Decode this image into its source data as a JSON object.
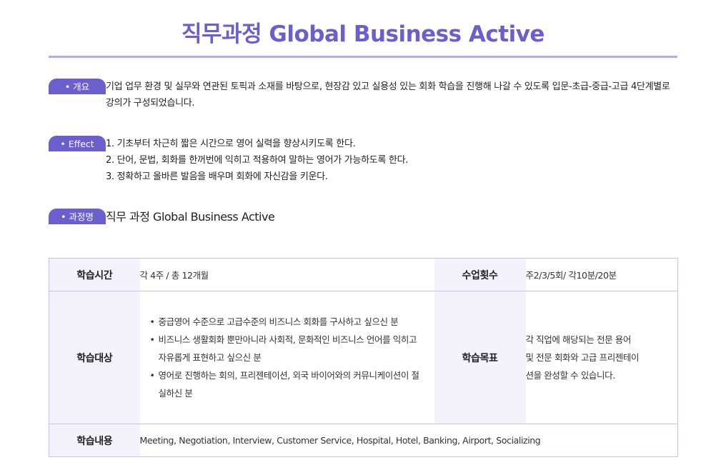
{
  "page": {
    "title": "직무과정 Global Business Active"
  },
  "sections": {
    "overview": {
      "label": "개요",
      "text": "기업 업무 환경 및 실무와 연관된 토픽과 소재를 바탕으로, 현장감 있고 실용성 있는 회화 학습을 진행해 나갈 수 있도록 입문-초급-중급-고급 4단계별로 강의가 구성되었습니다."
    },
    "effect": {
      "label": "Effect",
      "items": [
        "1. 기초부터 차근히 짧은 시간으로 영어 실력을 향상시키도록 한다.",
        "2. 단어, 문법, 회화를 한꺼번에 익히고 적용하여 말하는 영어가 가능하도록 한다.",
        "3. 정확하고 올바른 발음을 배우며 회화에 자신감을 키운다."
      ]
    },
    "course_name": {
      "label": "과정명",
      "text": "직무 과정 Global Business Active"
    }
  },
  "table": {
    "row1": {
      "duration_label": "학습시간",
      "duration_value": "각 4주 / 총 12개월",
      "frequency_label": "수업횟수",
      "frequency_value": "주2/3/5회/ 각10분/20분"
    },
    "row2": {
      "target_label": "학습대상",
      "target_items": [
        "중급영어 수준으로 고급수준의 비즈니스 회화를 구사하고 싶으신 분",
        "비즈니스 생활회화 뿐만아니라 사회적, 문화적인 비즈니스 언어를 익히고 자유롭게 표현하고 싶으신 분",
        "영어로 진행하는 회의, 프리젠테이션, 외국 바이어와의 커뮤니케이션이 절실하신 분"
      ],
      "goal_label": "학습목표",
      "goal_value": "각 직업에 해당되는 전문 용어 및 전문 회화와 고급 프리젠테이션을 완성할 수 있습니다."
    },
    "row3": {
      "content_label": "학습내용",
      "content_value": "Meeting, Negotiation, Interview, Customer Service, Hospital, Hotel, Banking, Airport, Socializing"
    }
  },
  "colors": {
    "accent": "#6b5fce",
    "rule": "#b3abea",
    "table_border": "#c6c1e6",
    "header_bg": "#f4f3fc"
  }
}
